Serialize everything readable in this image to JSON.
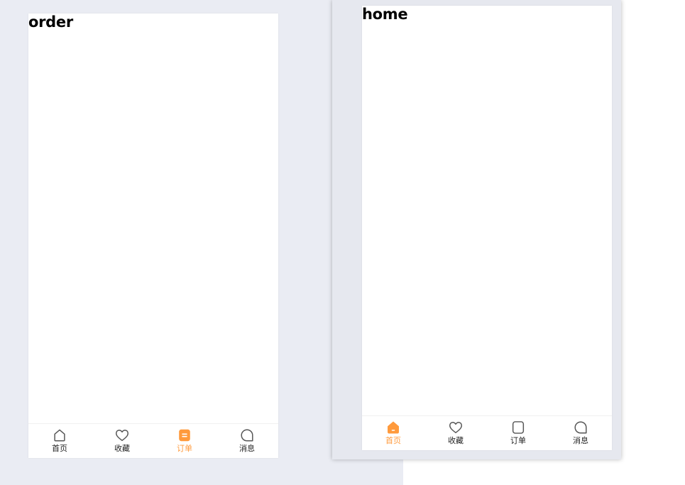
{
  "colors": {
    "accent": "#ff9a3c",
    "inactive_icon": "#555555",
    "label": "#222222"
  },
  "left_phone": {
    "page_title": "order",
    "tabs": [
      {
        "label": "首页",
        "icon": "home-icon",
        "active": false
      },
      {
        "label": "收藏",
        "icon": "heart-icon",
        "active": false
      },
      {
        "label": "订单",
        "icon": "order-icon",
        "active": true
      },
      {
        "label": "消息",
        "icon": "message-icon",
        "active": false
      }
    ]
  },
  "right_phone": {
    "page_title": "home",
    "tabs": [
      {
        "label": "首页",
        "icon": "home-icon",
        "active": true
      },
      {
        "label": "收藏",
        "icon": "heart-icon",
        "active": false
      },
      {
        "label": "订单",
        "icon": "order-icon",
        "active": false
      },
      {
        "label": "消息",
        "icon": "message-icon",
        "active": false
      }
    ]
  }
}
